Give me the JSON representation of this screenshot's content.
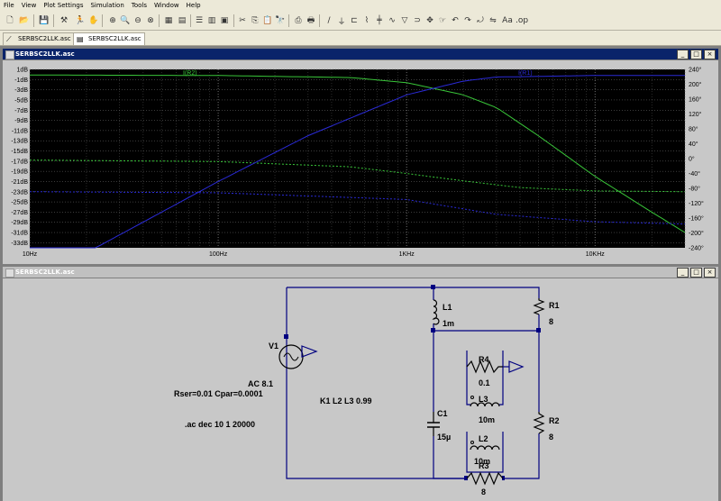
{
  "menu": [
    "File",
    "View",
    "Plot Settings",
    "Simulation",
    "Tools",
    "Window",
    "Help"
  ],
  "tabs": [
    {
      "label": "SERBSC2LLK.asc",
      "active": false
    },
    {
      "label": "SERBSC2LLK.asc",
      "active": true
    }
  ],
  "plot_window": {
    "title": "SERBSC2LLK.asc"
  },
  "schematic_window": {
    "title": "SERBSC2LLK.asc"
  },
  "colors": {
    "trace_green": "#39c539",
    "trace_blue": "#2a2ad6",
    "plot_bg": "#000000",
    "schematic_bg": "#c8c8c8",
    "wire": "#000080"
  },
  "chart_data": {
    "type": "line",
    "xscale": "log",
    "xlim": [
      10,
      30000
    ],
    "x_ticks": [
      "10Hz",
      "100Hz",
      "1KHz",
      "10KHz"
    ],
    "left_axis": {
      "unit": "dB",
      "ylim": [
        -34,
        1
      ],
      "ticks": [
        "1dB",
        "-1dB",
        "-3dB",
        "-5dB",
        "-7dB",
        "-9dB",
        "-11dB",
        "-13dB",
        "-15dB",
        "-17dB",
        "-19dB",
        "-21dB",
        "-23dB",
        "-25dB",
        "-27dB",
        "-29dB",
        "-31dB",
        "-33dB"
      ]
    },
    "right_axis": {
      "unit": "deg",
      "ylim": [
        -240,
        240
      ],
      "ticks": [
        "240°",
        "200°",
        "160°",
        "120°",
        "80°",
        "40°",
        "0°",
        "-40°",
        "-80°",
        "-120°",
        "-160°",
        "-200°",
        "-240°"
      ]
    },
    "grid": true,
    "series": [
      {
        "name": "I(R2)",
        "color": "#39c539",
        "magnitude_db": [
          [
            10,
            -0.1
          ],
          [
            100,
            -0.2
          ],
          [
            500,
            -0.6
          ],
          [
            1000,
            -1.6
          ],
          [
            2000,
            -4
          ],
          [
            3000,
            -6.5
          ],
          [
            5000,
            -12
          ],
          [
            10000,
            -20
          ],
          [
            20000,
            -27
          ],
          [
            30000,
            -31
          ]
        ],
        "phase_deg": [
          [
            10,
            -4
          ],
          [
            100,
            -8
          ],
          [
            500,
            -22
          ],
          [
            1000,
            -40
          ],
          [
            2000,
            -60
          ],
          [
            4000,
            -78
          ],
          [
            10000,
            -87
          ],
          [
            30000,
            -89
          ]
        ]
      },
      {
        "name": "I(R1)",
        "color": "#2a2ad6",
        "magnitude_db": [
          [
            10,
            -41
          ],
          [
            100,
            -21
          ],
          [
            300,
            -12
          ],
          [
            1000,
            -4
          ],
          [
            2000,
            -1.3
          ],
          [
            3000,
            -0.5
          ],
          [
            10000,
            -0.2
          ],
          [
            30000,
            -0.2
          ]
        ],
        "phase_deg": [
          [
            10,
            -89
          ],
          [
            100,
            -92
          ],
          [
            1000,
            -110
          ],
          [
            3000,
            -150
          ],
          [
            10000,
            -170
          ],
          [
            30000,
            -176
          ]
        ]
      }
    ]
  },
  "schematic": {
    "components": [
      {
        "ref": "V1",
        "value": ""
      },
      {
        "ref": "L1",
        "value": "1m"
      },
      {
        "ref": "R1",
        "value": "8"
      },
      {
        "ref": "R4",
        "value": "0.1"
      },
      {
        "ref": "L3",
        "value": "10m"
      },
      {
        "ref": "C1",
        "value": "15µ"
      },
      {
        "ref": "L2",
        "value": "10m"
      },
      {
        "ref": "R2",
        "value": "8"
      },
      {
        "ref": "R3",
        "value": "8"
      }
    ],
    "source_spec": "AC 8.1",
    "source_params": "Rser=0.01 Cpar=0.0001",
    "coupling": "K1 L2 L3 0.99",
    "directive": ".ac dec 10 1 20000"
  }
}
